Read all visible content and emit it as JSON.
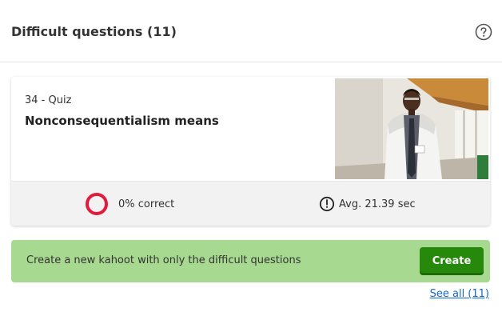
{
  "header": {
    "title": "Difficult questions (11)",
    "help_icon": "question-circle-icon"
  },
  "question_card": {
    "meta": "34 - Quiz",
    "question": "Nonconsequentialism means",
    "image": "photo of a man in a white lab coat in a hallway",
    "correct_label": "0% correct",
    "correct_percent": 0,
    "time_label": "Avg. 21.39 sec",
    "time_icon": "clock-icon"
  },
  "banner": {
    "text": "Create a new kahoot with only the difficult questions",
    "button_label": "Create"
  },
  "see_all_label": "See all (11)",
  "colors": {
    "banner_bg": "#a8d990",
    "create_button": "#26890c",
    "incorrect_ring": "#e21b3c",
    "link": "#1368ce"
  }
}
